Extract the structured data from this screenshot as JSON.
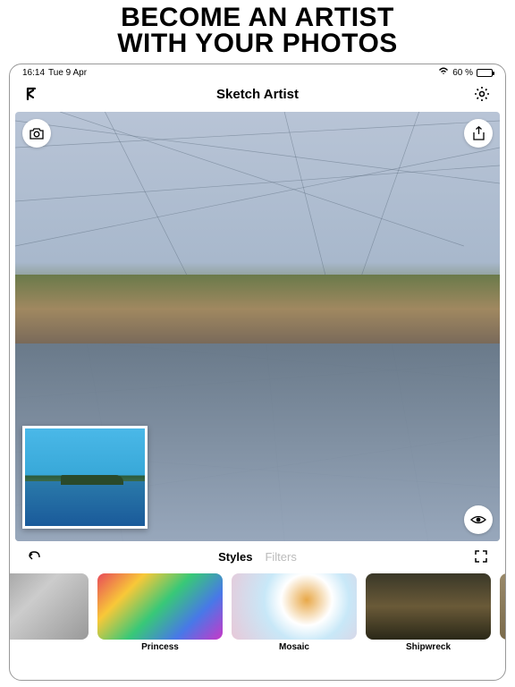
{
  "promo": {
    "line1": "BECOME AN ARTIST",
    "line2": "WITH YOUR PHOTOS"
  },
  "status_bar": {
    "time": "16:14",
    "date": "Tue 9 Apr",
    "wifi": "wifi",
    "battery_pct": "60 %",
    "battery_level": 60
  },
  "nav": {
    "title": "Sketch Artist",
    "back_icon": "K",
    "settings_icon": "gear"
  },
  "canvas": {
    "camera_icon": "camera",
    "share_icon": "share",
    "eye_icon": "eye"
  },
  "tabs": {
    "undo_icon": "undo",
    "expand_icon": "expand",
    "items": [
      {
        "label": "Styles",
        "active": true
      },
      {
        "label": "Filters",
        "active": false
      }
    ]
  },
  "styles": [
    {
      "label": "",
      "thumbClass": "thumb-gray"
    },
    {
      "label": "Princess",
      "thumbClass": "thumb-princess"
    },
    {
      "label": "Mosaic",
      "thumbClass": "thumb-mosaic"
    },
    {
      "label": "Shipwreck",
      "thumbClass": "thumb-shipwreck"
    },
    {
      "label": "",
      "thumbClass": "thumb-wall"
    }
  ]
}
